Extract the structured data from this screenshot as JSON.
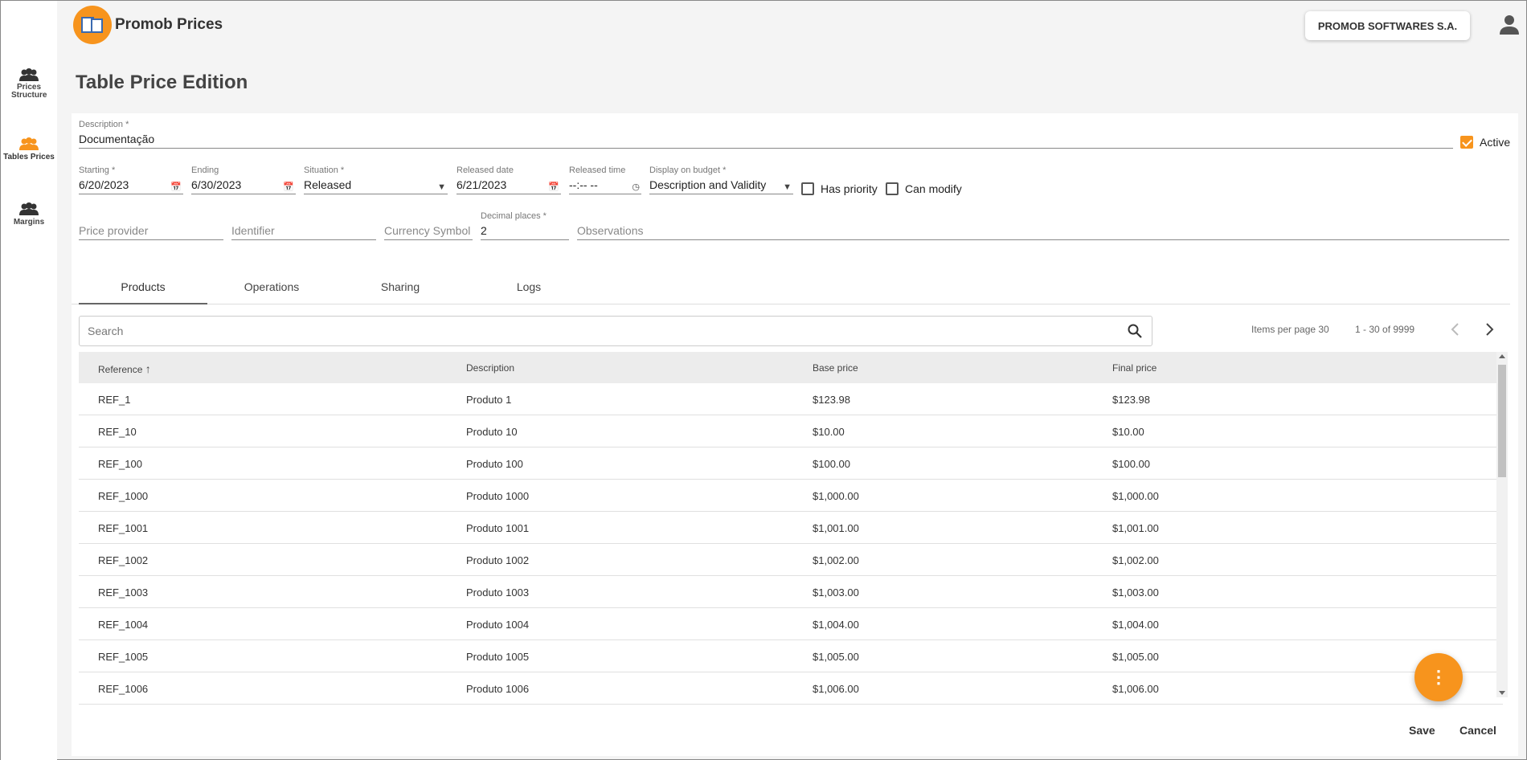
{
  "app": {
    "title": "Promob Prices",
    "company": "PROMOB SOFTWARES S.A."
  },
  "sidebar": {
    "items": [
      {
        "label": "Prices Structure",
        "icon": "people-icon"
      },
      {
        "label": "Tables Prices",
        "icon": "people-icon",
        "active": true
      },
      {
        "label": "Margins",
        "icon": "people-icon"
      }
    ]
  },
  "page": {
    "title": "Table Price Edition"
  },
  "form": {
    "description": {
      "label": "Description *",
      "value": "Documentação"
    },
    "active": {
      "label": "Active",
      "checked": true
    },
    "starting": {
      "label": "Starting *",
      "value": "6/20/2023"
    },
    "ending": {
      "label": "Ending",
      "value": "6/30/2023"
    },
    "situation": {
      "label": "Situation *",
      "value": "Released"
    },
    "released_date": {
      "label": "Released date",
      "value": "6/21/2023"
    },
    "released_time": {
      "label": "Released time",
      "value": "--:-- --"
    },
    "display_on_budget": {
      "label": "Display on budget *",
      "value": "Description and Validity"
    },
    "has_priority": {
      "label": "Has priority",
      "checked": false
    },
    "can_modify": {
      "label": "Can modify",
      "checked": false
    },
    "price_provider": {
      "placeholder": "Price provider"
    },
    "identifier": {
      "placeholder": "Identifier"
    },
    "currency_symbol": {
      "placeholder": "Currency Symbol"
    },
    "decimal_places": {
      "label": "Decimal places *",
      "value": "2"
    },
    "observations": {
      "placeholder": "Observations"
    }
  },
  "tabs": [
    "Products",
    "Operations",
    "Sharing",
    "Logs"
  ],
  "search": {
    "placeholder": "Search"
  },
  "pager": {
    "items_per_page": "Items per page 30",
    "range": "1 - 30 of 9999"
  },
  "table": {
    "headers": [
      "Reference",
      "Description",
      "Base price",
      "Final price"
    ],
    "rows": [
      [
        "REF_1",
        "Produto 1",
        "$123.98",
        "$123.98"
      ],
      [
        "REF_10",
        "Produto 10",
        "$10.00",
        "$10.00"
      ],
      [
        "REF_100",
        "Produto 100",
        "$100.00",
        "$100.00"
      ],
      [
        "REF_1000",
        "Produto 1000",
        "$1,000.00",
        "$1,000.00"
      ],
      [
        "REF_1001",
        "Produto 1001",
        "$1,001.00",
        "$1,001.00"
      ],
      [
        "REF_1002",
        "Produto 1002",
        "$1,002.00",
        "$1,002.00"
      ],
      [
        "REF_1003",
        "Produto 1003",
        "$1,003.00",
        "$1,003.00"
      ],
      [
        "REF_1004",
        "Produto 1004",
        "$1,004.00",
        "$1,004.00"
      ],
      [
        "REF_1005",
        "Produto 1005",
        "$1,005.00",
        "$1,005.00"
      ],
      [
        "REF_1006",
        "Produto 1006",
        "$1,006.00",
        "$1,006.00"
      ]
    ]
  },
  "actions": {
    "fab": "⋮",
    "save": "Save",
    "cancel": "Cancel"
  },
  "colors": {
    "accent": "#f7941d"
  }
}
